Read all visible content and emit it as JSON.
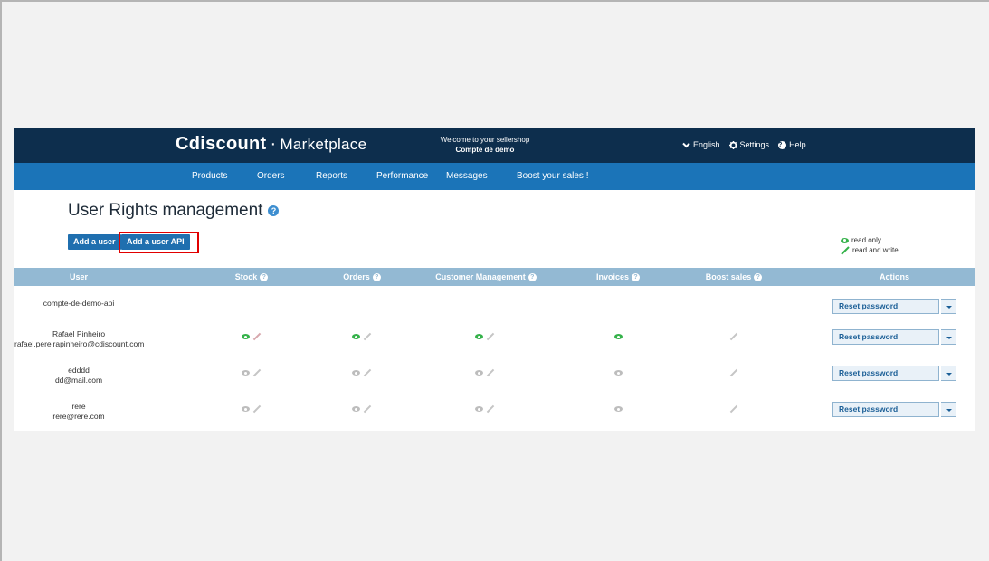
{
  "header": {
    "logo_brand": "Cdiscount",
    "logo_separator": "·",
    "logo_product": "Marketplace",
    "welcome_line": "Welcome to your sellershop",
    "shop_name": "Compte de demo",
    "language_label": "English",
    "settings_label": "Settings",
    "help_label": "Help"
  },
  "nav": {
    "items": [
      "Products",
      "Orders",
      "Reports",
      "Performance",
      "Messages",
      "Boost your sales !"
    ]
  },
  "page": {
    "title": "User Rights management",
    "add_user_label": "Add a user",
    "add_user_api_label": "Add a user API",
    "legend_read_only": "read only",
    "legend_read_write": "read and write"
  },
  "table": {
    "headers": [
      "User",
      "Stock",
      "Orders",
      "Customer Management",
      "Invoices",
      "Boost sales",
      "Actions"
    ],
    "rows": [
      {
        "name": "compte-de-demo-api",
        "email": "",
        "rights": {
          "stock": "none",
          "orders": "none",
          "customer": "none",
          "invoices": "none",
          "boost": "none"
        }
      },
      {
        "name": "Rafael Pinheiro",
        "email": "rafael.pereirapinheiro@cdiscount.com",
        "rights": {
          "stock": "read-active",
          "orders": "read-active",
          "customer": "read-active",
          "invoices": "read-only-active",
          "boost": "write-only"
        }
      },
      {
        "name": "edddd",
        "email": "dd@mail.com",
        "rights": {
          "stock": "inactive",
          "orders": "inactive",
          "customer": "inactive",
          "invoices": "read-only-inactive",
          "boost": "write-only"
        }
      },
      {
        "name": "rere",
        "email": "rere@rere.com",
        "rights": {
          "stock": "inactive",
          "orders": "inactive",
          "customer": "inactive",
          "invoices": "read-only-inactive",
          "boost": "write-only"
        }
      }
    ],
    "action_label": "Reset password"
  },
  "colors": {
    "topbar": "#0d2e4d",
    "navbar": "#1b74b8",
    "table_header": "#93b9d3",
    "active_eye": "#35b24a",
    "highlight_box": "#e10000"
  },
  "icons": {
    "read": "eye-icon",
    "write": "pencil-icon",
    "help": "question-circle-icon",
    "settings": "gear-icon",
    "language": "chevron-down-icon",
    "dropdown": "caret-down-icon"
  }
}
